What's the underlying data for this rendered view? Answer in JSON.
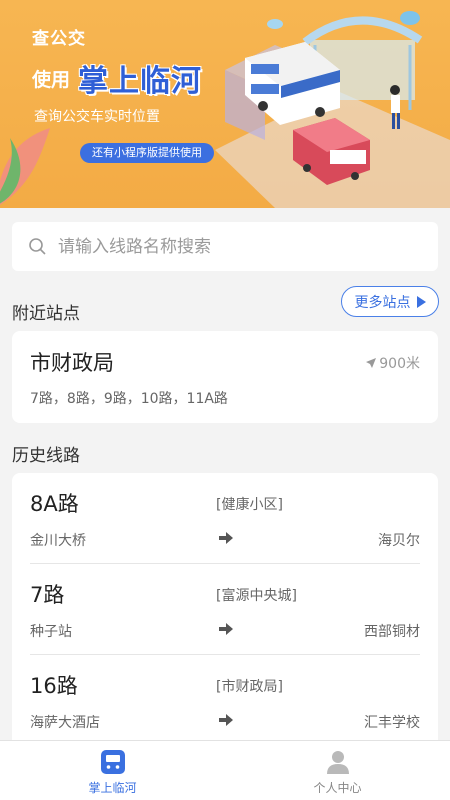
{
  "banner": {
    "line1": "查公交",
    "line2_prefix": "使用",
    "line2_brand": "掌上临河",
    "subtitle": "查询公交车实时位置",
    "pill": "还有小程序版提供使用",
    "colors": {
      "bg": "#f5b04c",
      "brand": "#2f5fd6",
      "pill": "#3b6fe0"
    }
  },
  "search": {
    "placeholder": "请输入线路名称搜索",
    "icon": "search-icon"
  },
  "nearby": {
    "title": "附近站点",
    "more_label": "更多站点",
    "station": {
      "name": "市财政局",
      "distance": "900米",
      "lines": "7路，8路，9路，10路，11A路"
    }
  },
  "history": {
    "title": "历史线路",
    "routes": [
      {
        "name": "8A路",
        "direction": "[健康小区]",
        "from": "金川大桥",
        "to": "海贝尔"
      },
      {
        "name": "7路",
        "direction": "[富源中央城]",
        "from": "种子站",
        "to": "西部铜材"
      },
      {
        "name": "16路",
        "direction": "[市财政局]",
        "from": "海萨大酒店",
        "to": "汇丰学校"
      }
    ]
  },
  "tabbar": {
    "tabs": [
      {
        "label": "掌上临河",
        "icon": "bus-icon",
        "active": true
      },
      {
        "label": "个人中心",
        "icon": "user-icon",
        "active": false
      }
    ]
  }
}
